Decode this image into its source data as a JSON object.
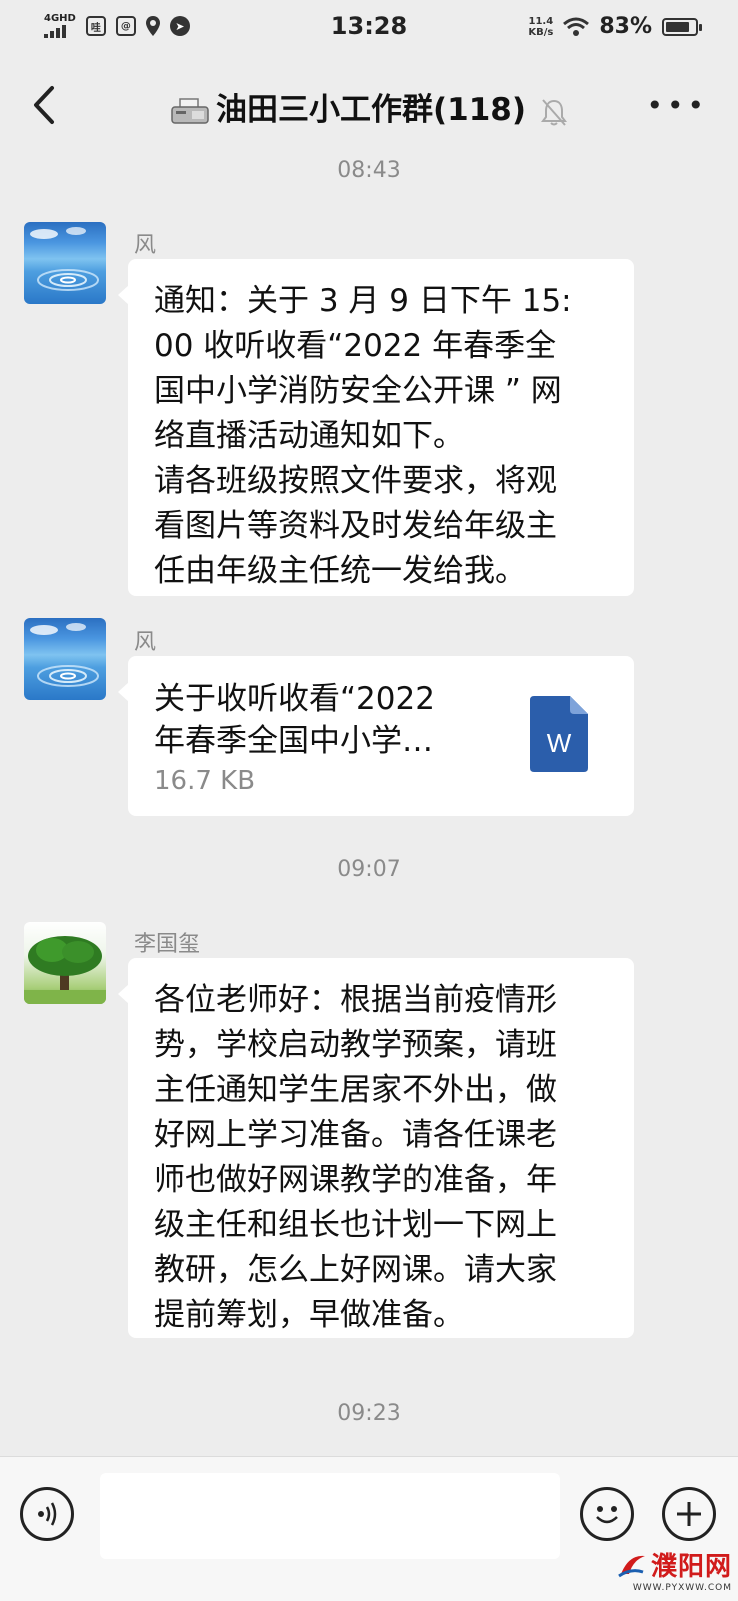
{
  "status_bar": {
    "network": "4GHD",
    "time": "13:28",
    "speed_value": "11.4",
    "speed_unit": "KB/s",
    "battery": "83%",
    "battery_level": 0.83
  },
  "header": {
    "title": "油田三小工作群(118)",
    "icons": [
      "back-icon",
      "fax-icon",
      "mute-bell-icon",
      "more-icon"
    ]
  },
  "messages": {
    "ts1": "08:43",
    "m1_sender": "风",
    "m1_text": "通知：关于 3 月 9 日下午 15:\n00 收听收看“2022 年春季全\n国中小学消防安全公开课 ” 网\n络直播活动通知如下。\n请各班级按照文件要求，将观\n看图片等资料及时发给年级主\n任由年级主任统一发给我。",
    "m2_sender": "风",
    "m2_file_line1": "关于收听收看“2022",
    "m2_file_line2": "年春季全国中小学…",
    "m2_file_size": "16.7 KB",
    "m2_file_badge": "W",
    "ts2": "09:07",
    "m3_sender": "李国玺",
    "m3_text": "各位老师好：根据当前疫情形\n势，学校启动教学预案，请班\n主任通知学生居家不外出，做\n好网上学习准备。请各任课老\n师也做好网课教学的准备，年\n级主任和组长也计划一下网上\n教研，怎么上好网课。请大家\n提前筹划，早做准备。",
    "ts3": "09:23"
  },
  "input_bar": {
    "icons": [
      "voice-icon",
      "emoji-icon",
      "plus-icon"
    ]
  },
  "watermark": {
    "name": "濮阳网",
    "url": "WWW.PYXWW.COM"
  },
  "colors": {
    "background": "#ededed",
    "bubble": "#ffffff",
    "word_blue": "#2b5eab",
    "watermark_red": "#d11b1b"
  }
}
